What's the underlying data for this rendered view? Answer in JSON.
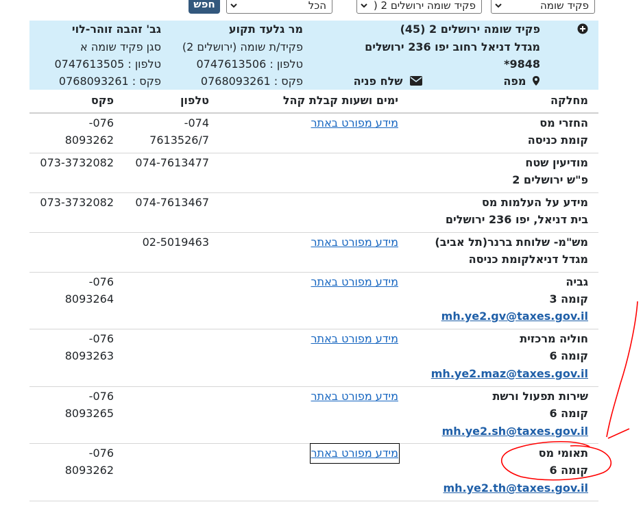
{
  "filters": {
    "office_type": "פקיד שומה",
    "office": "פקיד שומה ירושלים 2 (",
    "scope": "הכל",
    "search_label": "חפש"
  },
  "office": {
    "title": "פקיד שומה ירושלים 2 (45)",
    "address_line1": "מגדל דניאל רחוב יפו 236 ירושלים",
    "address_line2": "9848*",
    "map_label": "מפה",
    "send_label": "שלח פניה",
    "contacts": [
      {
        "name": "מר גלעד תקוע",
        "role": "פקיד/ת שומה (ירושלים 2)",
        "phone": "טלפון : 0747613506",
        "fax": "פקס : 0768093261"
      },
      {
        "name": "גב' זהבה זוהר-לוי",
        "role": "סגן פקיד שומה א",
        "phone": "טלפון : 0747613505",
        "fax": "פקס : 0768093261"
      }
    ]
  },
  "table": {
    "headers": {
      "department": "מחלקה",
      "hours": "ימים ושעות קבלת קהל",
      "phone": "טלפון",
      "fax": "פקס"
    },
    "rows": [
      {
        "name": "החזרי מס",
        "location": "קומת כניסה",
        "email": "",
        "hours": "מידע מפורט באתר",
        "phone1": "074-",
        "phone2": "7613526/7",
        "fax1": "076-",
        "fax2": "8093262"
      },
      {
        "name": "מודיעין שטח",
        "location": "פ\"ש ירושלים 2",
        "email": "",
        "hours": "",
        "phone1": "074-7613477",
        "phone2": "",
        "fax1": "073-3732082",
        "fax2": ""
      },
      {
        "name": "מידע על העלמות מס",
        "location": "בית דניאל, יפו 236 ירושלים",
        "email": "",
        "hours": "",
        "phone1": "074-7613467",
        "phone2": "",
        "fax1": "073-3732082",
        "fax2": ""
      },
      {
        "name": "מש\"מ- שלוחת ברנר(תל אביב)",
        "location": "מגדל דניאלקומת כניסה",
        "email": "",
        "hours": "מידע מפורט באתר",
        "phone1": "02-5019463",
        "phone2": "",
        "fax1": "",
        "fax2": ""
      },
      {
        "name": "גביה",
        "location": "קומה 3",
        "email": "mh.ye2.gv@taxes.gov.il",
        "hours": "מידע מפורט באתר",
        "phone1": "",
        "phone2": "",
        "fax1": "076-",
        "fax2": "8093264"
      },
      {
        "name": "חוליה מרכזית",
        "location": "קומה 6",
        "email": "mh.ye2.maz@taxes.gov.il",
        "hours": "מידע מפורט באתר",
        "phone1": "",
        "phone2": "",
        "fax1": "076-",
        "fax2": "8093263"
      },
      {
        "name": "שירות תפעול ורשת",
        "location": "קומה 6",
        "email": "mh.ye2.sh@taxes.gov.il",
        "hours": "מידע מפורט באתר",
        "phone1": "",
        "phone2": "",
        "fax1": "076-",
        "fax2": "8093265"
      },
      {
        "name": "תאומי מס",
        "location": "קומה 6",
        "email": "mh.ye2.th@taxes.gov.il",
        "hours": "מידע מפורט באתר",
        "phone1": "",
        "phone2": "",
        "fax1": "076-",
        "fax2": "8093262"
      }
    ]
  },
  "annotation": {
    "color": "#ff0000"
  }
}
